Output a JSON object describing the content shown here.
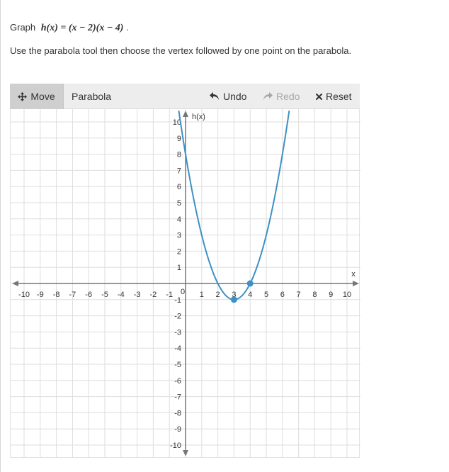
{
  "question": {
    "graph_label": "Graph",
    "function": "h(x) = (x − 2)(x − 4)",
    "period": ".",
    "instruction": "Use the parabola tool then choose the vertex followed by one point on the parabola."
  },
  "toolbar": {
    "move_label": "Move",
    "parabola_label": "Parabola",
    "undo_label": "Undo",
    "redo_label": "Redo",
    "reset_label": "Reset"
  },
  "colors": {
    "curve": "#3d91c4",
    "grid": "#dedede",
    "axis": "#777777",
    "toolbar_bg": "#ededed",
    "active_tool_bg": "#cfcfcf"
  },
  "chart_data": {
    "type": "line",
    "x_axis_label": "x",
    "y_axis_label": "h(x)",
    "xlim": [
      -10,
      10
    ],
    "ylim": [
      -10,
      10
    ],
    "x_ticks": [
      -10,
      -9,
      -8,
      -7,
      -6,
      -5,
      -4,
      -3,
      -2,
      -1,
      1,
      2,
      3,
      4,
      5,
      6,
      7,
      8,
      9,
      10
    ],
    "y_ticks": [
      -10,
      -9,
      -8,
      -7,
      -6,
      -5,
      -4,
      -3,
      -2,
      -1,
      1,
      2,
      3,
      4,
      5,
      6,
      7,
      8,
      9,
      10
    ],
    "origin_label": "0",
    "grid": true,
    "parabola": {
      "vertex": [
        3,
        -1
      ],
      "point": [
        4,
        0
      ]
    }
  }
}
